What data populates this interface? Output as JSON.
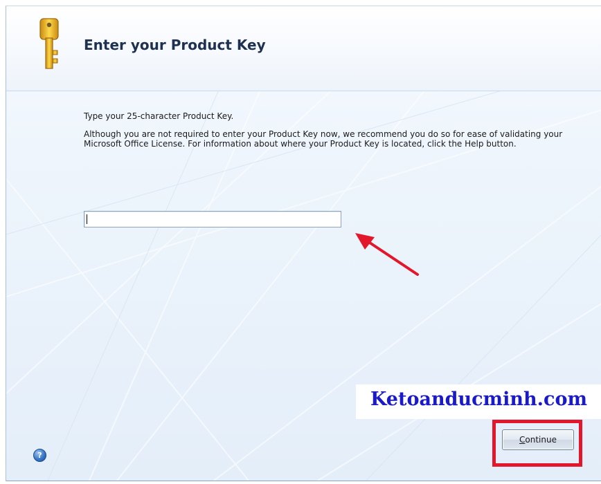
{
  "dialog": {
    "title": "Enter your Product Key",
    "instruction": "Type your 25-character Product Key.",
    "description": "Although you are not required to enter your Product Key now, we recommend you do so for ease of validating your Microsoft Office License. For information about where your Product Key is located, click the Help button.",
    "product_key_value": "",
    "continue_label": "Continue",
    "help_symbol": "?"
  },
  "overlay": {
    "watermark": "Ketoanducminh.com",
    "watermark_color": "#1a1ac8",
    "highlight_color": "#e3172b",
    "arrow_color": "#e3172b"
  },
  "icons": {
    "header": "key-icon",
    "help": "help-icon"
  }
}
